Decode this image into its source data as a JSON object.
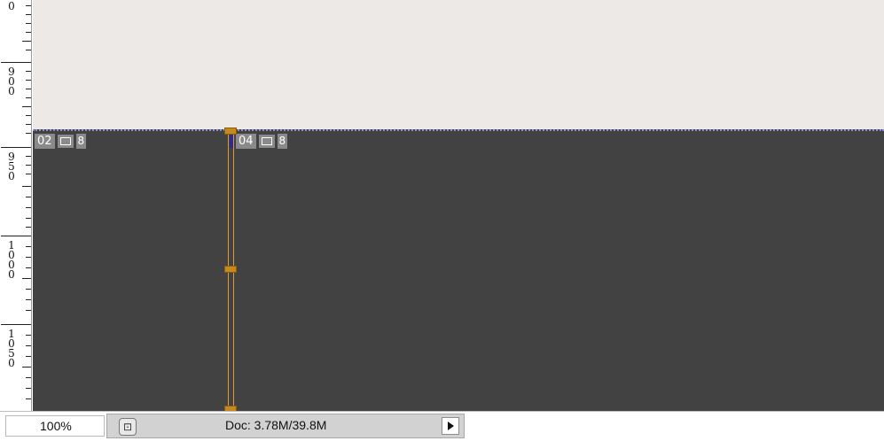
{
  "ruler": {
    "labels": [
      "0",
      "900",
      "950",
      "1000",
      "1050"
    ]
  },
  "canvas": {
    "colors": {
      "light_area": "#ece9e6",
      "dark_area": "#424242",
      "slice_guide": "#e09a30"
    },
    "slices": [
      {
        "number": "02",
        "badge": "8"
      },
      {
        "number": "04",
        "badge": "8"
      }
    ]
  },
  "status": {
    "zoom": "100%",
    "doc_info": "Doc: 3.78M/39.8M"
  },
  "icons": {
    "profile": "profile-icon",
    "slice_image": "image-slice-icon",
    "menu": "triangle-right-icon"
  }
}
